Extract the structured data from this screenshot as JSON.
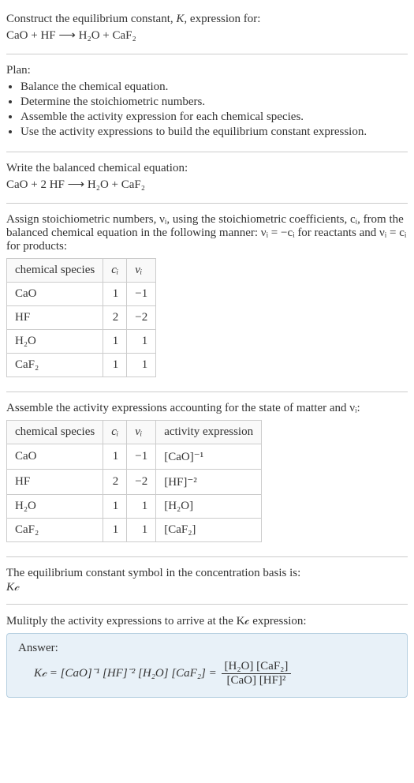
{
  "intro": {
    "line1": "Construct the equilibrium constant, K, expression for:",
    "equation": "CaO + HF ⟶ H₂O + CaF₂"
  },
  "plan": {
    "heading": "Plan:",
    "items": [
      "Balance the chemical equation.",
      "Determine the stoichiometric numbers.",
      "Assemble the activity expression for each chemical species.",
      "Use the activity expressions to build the equilibrium constant expression."
    ]
  },
  "balanced": {
    "heading": "Write the balanced chemical equation:",
    "equation": "CaO + 2 HF ⟶ H₂O + CaF₂"
  },
  "stoich_intro": "Assign stoichiometric numbers, νᵢ, using the stoichiometric coefficients, cᵢ, from the balanced chemical equation in the following manner: νᵢ = −cᵢ for reactants and νᵢ = cᵢ for products:",
  "table1": {
    "headers": [
      "chemical species",
      "cᵢ",
      "νᵢ"
    ],
    "rows": [
      [
        "CaO",
        "1",
        "−1"
      ],
      [
        "HF",
        "2",
        "−2"
      ],
      [
        "H₂O",
        "1",
        "1"
      ],
      [
        "CaF₂",
        "1",
        "1"
      ]
    ]
  },
  "activity_intro": "Assemble the activity expressions accounting for the state of matter and νᵢ:",
  "table2": {
    "headers": [
      "chemical species",
      "cᵢ",
      "νᵢ",
      "activity expression"
    ],
    "rows": [
      [
        "CaO",
        "1",
        "−1",
        "[CaO]⁻¹"
      ],
      [
        "HF",
        "2",
        "−2",
        "[HF]⁻²"
      ],
      [
        "H₂O",
        "1",
        "1",
        "[H₂O]"
      ],
      [
        "CaF₂",
        "1",
        "1",
        "[CaF₂]"
      ]
    ]
  },
  "symbol_intro": "The equilibrium constant symbol in the concentration basis is:",
  "symbol": "K𝒸",
  "multiply_intro": "Mulitply the activity expressions to arrive at the K𝒸 expression:",
  "answer": {
    "label": "Answer:",
    "lhs": "K𝒸 = [CaO]⁻¹ [HF]⁻² [H₂O] [CaF₂] = ",
    "frac_num": "[H₂O] [CaF₂]",
    "frac_den": "[CaO] [HF]²"
  },
  "chart_data": {
    "type": "table",
    "tables": [
      {
        "title": "Stoichiometric numbers",
        "columns": [
          "chemical species",
          "c_i",
          "nu_i"
        ],
        "rows": [
          {
            "chemical species": "CaO",
            "c_i": 1,
            "nu_i": -1
          },
          {
            "chemical species": "HF",
            "c_i": 2,
            "nu_i": -2
          },
          {
            "chemical species": "H2O",
            "c_i": 1,
            "nu_i": 1
          },
          {
            "chemical species": "CaF2",
            "c_i": 1,
            "nu_i": 1
          }
        ]
      },
      {
        "title": "Activity expressions",
        "columns": [
          "chemical species",
          "c_i",
          "nu_i",
          "activity expression"
        ],
        "rows": [
          {
            "chemical species": "CaO",
            "c_i": 1,
            "nu_i": -1,
            "activity expression": "[CaO]^-1"
          },
          {
            "chemical species": "HF",
            "c_i": 2,
            "nu_i": -2,
            "activity expression": "[HF]^-2"
          },
          {
            "chemical species": "H2O",
            "c_i": 1,
            "nu_i": 1,
            "activity expression": "[H2O]"
          },
          {
            "chemical species": "CaF2",
            "c_i": 1,
            "nu_i": 1,
            "activity expression": "[CaF2]"
          }
        ]
      }
    ]
  }
}
